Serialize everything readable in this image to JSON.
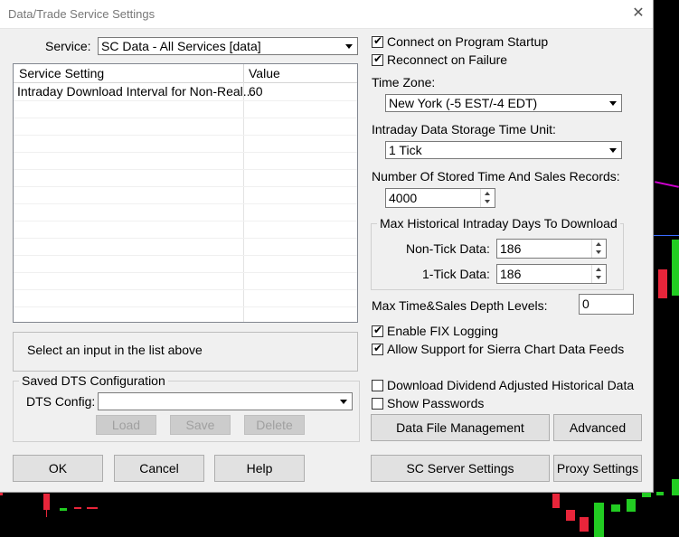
{
  "window": {
    "title": "Data/Trade Service Settings",
    "close_icon": "close-icon"
  },
  "service": {
    "label": "Service:",
    "value": "SC Data - All Services    [data]"
  },
  "grid": {
    "headers": [
      "Service Setting",
      "Value"
    ],
    "rows": [
      {
        "setting": "Intraday Download Interval for Non-Real...",
        "value": "60"
      }
    ]
  },
  "hint": "Select an input in the list above",
  "saved_dts": {
    "title": "Saved DTS Configuration",
    "label": "DTS Config:",
    "value": "",
    "load": "Load",
    "save": "Save",
    "delete": "Delete"
  },
  "checks": {
    "connect_startup": {
      "label": "Connect on Program Startup",
      "checked": true
    },
    "reconnect": {
      "label": "Reconnect on Failure",
      "checked": true
    },
    "fix_logging": {
      "label": "Enable FIX Logging",
      "checked": true
    },
    "sierra_feeds": {
      "label": "Allow Support for Sierra Chart Data Feeds",
      "checked": true
    },
    "dividend": {
      "label": "Download Dividend Adjusted Historical Data",
      "checked": false
    },
    "passwords": {
      "label": "Show Passwords",
      "checked": false
    }
  },
  "timezone": {
    "label": "Time Zone:",
    "value": "New York (-5 EST/-4 EDT)"
  },
  "storage_unit": {
    "label": "Intraday Data Storage Time Unit:",
    "value": "1 Tick"
  },
  "stored_records": {
    "label": "Number Of Stored Time And Sales Records:",
    "value": "4000"
  },
  "hist_days": {
    "title": "Max Historical Intraday Days To Download",
    "non_tick_label": "Non-Tick Data:",
    "non_tick_value": "186",
    "one_tick_label": "1-Tick Data:",
    "one_tick_value": "186"
  },
  "depth": {
    "label": "Max Time&Sales Depth Levels:",
    "value": "0"
  },
  "buttons": {
    "data_file": "Data File Management",
    "advanced": "Advanced",
    "ok": "OK",
    "cancel": "Cancel",
    "help": "Help",
    "server": "SC Server Settings",
    "proxy": "Proxy Settings"
  },
  "colors": {
    "dialog_bg": "#f0f0f0",
    "chart_bg": "#000000",
    "candle_red": "#e8253a",
    "candle_green": "#22cc22"
  }
}
